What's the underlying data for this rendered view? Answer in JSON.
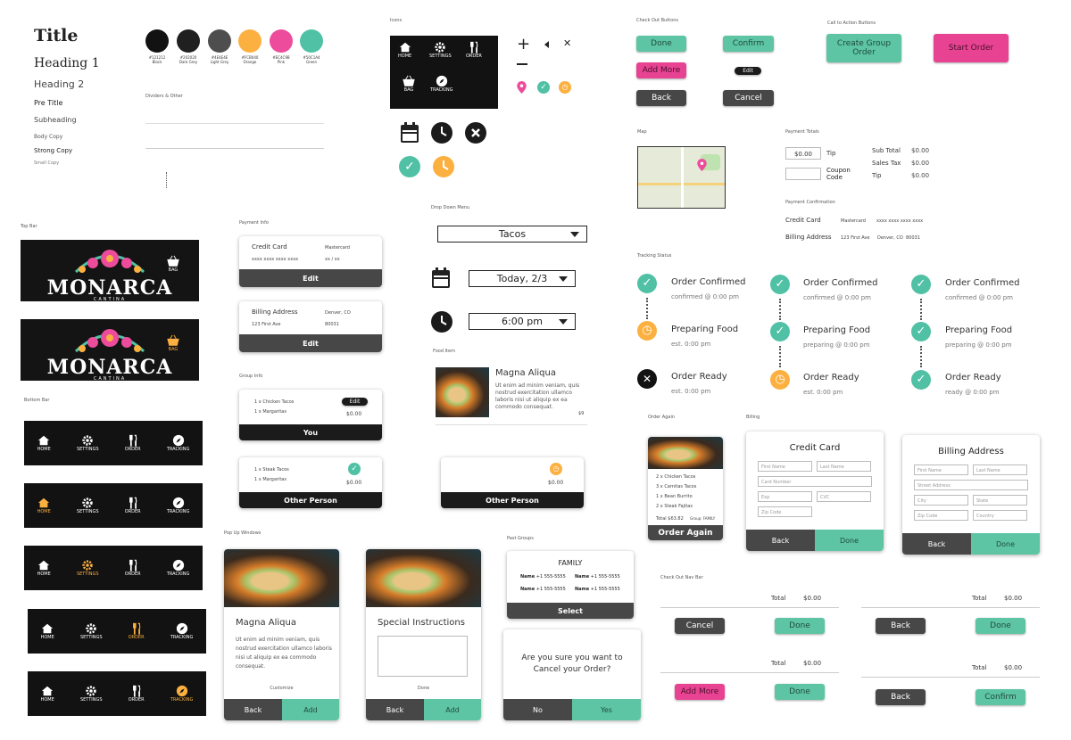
{
  "typography": {
    "title": "Title",
    "h1": "Heading 1",
    "h2": "Heading 2",
    "pre": "Pre Title",
    "sub": "Subheading",
    "body": "Body Copy",
    "strong": "Strong Copy",
    "small": "Small Copy"
  },
  "swatches": [
    {
      "hex": "#121212",
      "name": "Black"
    },
    {
      "hex": "#202020",
      "name": "Dark Grey"
    },
    {
      "hex": "#4E4E4E",
      "name": "Light Grey"
    },
    {
      "hex": "#FCB040",
      "name": "Orange"
    },
    {
      "hex": "#EC4C9B",
      "name": "Pink"
    },
    {
      "hex": "#50C1A4",
      "name": "Green"
    }
  ],
  "colors": {
    "black": "#121212",
    "dark_grey": "#202020",
    "light_grey": "#4E4E4E",
    "orange": "#FCB040",
    "pink": "#EC4C9B",
    "green": "#50C1A4"
  },
  "labels": {
    "dividers": "Dividers & Other",
    "icons": "Icons",
    "checkout_buttons": "Check Out Buttons",
    "cta_buttons": "Call to Action Buttons",
    "top_bar": "Top Bar",
    "bottom_bar": "Bottom Bar",
    "payment_info": "Payment Info",
    "group_info": "Group Info",
    "dropdown": "Drop Down Menu",
    "food_item": "Food Item",
    "map": "Map",
    "payment_totals": "Payment Totals",
    "payment_confirmation": "Payment Confirmation",
    "tracking_status": "Tracking Status",
    "order_again": "Order Again",
    "billing": "Billing",
    "popups": "Pop Up Windows",
    "past_groups": "Past Groups",
    "checkout_nav": "Check Out Nav Bar"
  },
  "nav": {
    "home": "HOME",
    "settings": "SETTINGS",
    "order": "ORDER",
    "bag": "BAG",
    "tracking": "TRACKING"
  },
  "brand": {
    "name": "MONARCA",
    "sub": "CANTINA",
    "bag": "BAG"
  },
  "checkout": {
    "done": "Done",
    "confirm": "Confirm",
    "add_more": "Add More",
    "edit": "Edit",
    "back": "Back",
    "cancel": "Cancel"
  },
  "cta": {
    "create_group": "Create Group Order",
    "start_order": "Start Order"
  },
  "payment_card": {
    "title": "Credit Card",
    "type": "Mastercard",
    "number": "xxxx xxxx xxxx xxxx",
    "exp": "xx / xx",
    "edit": "Edit"
  },
  "billing_card": {
    "title": "Billing Address",
    "city": "Denver, CO",
    "street": "123 First Ave",
    "zip": "80031",
    "edit": "Edit"
  },
  "group_you": {
    "items": [
      "1 x Chicken Tacos",
      "1 x Margaritas"
    ],
    "edit": "Edit",
    "price": "$0.00",
    "name": "You"
  },
  "group_other": {
    "items": [
      "1 x Steak Tacos",
      "1 x Margaritas"
    ],
    "price": "$0.00",
    "name": "Other Person"
  },
  "group_other2": {
    "price": "$0.00",
    "name": "Other Person"
  },
  "dropdowns": {
    "menu": "Tacos",
    "date": "Today, 2/3",
    "time": "6:00 pm"
  },
  "food": {
    "name": "Magna Aliqua",
    "desc": "Ut enim ad minim veniam, quis nostrud exercitation ullamco laboris nisi ut aliquip ex ea commodo consequat.",
    "price": "$9"
  },
  "totals": {
    "tip_value": "$0.00",
    "tip": "Tip",
    "coupon": "Coupon Code",
    "subtotal": "Sub Total",
    "sales_tax": "Sales Tax",
    "tip2": "Tip",
    "v1": "$0.00",
    "v2": "$0.00",
    "v3": "$0.00"
  },
  "confirmation": {
    "card": "Credit Card",
    "card_type": "Mastercard",
    "card_num": "xxxx xxxx xxxx xxxx",
    "billing": "Billing Address",
    "street": "123 First Ave",
    "city": "Denver, CO",
    "zip": "80031"
  },
  "tracking": {
    "confirmed": "Order Confirmed",
    "confirmed_at": "confirmed @ 0:00 pm",
    "preparing": "Preparing Food",
    "est": "est. 0:00 pm",
    "preparing_at": "preparing @ 0:00 pm",
    "ready": "Order Ready",
    "ready_at": "ready @ 0:00 pm"
  },
  "order_again": {
    "items": [
      "2 x Chicken Tacos",
      "3 x Carnitas Tacos",
      "1 x Bean Burrito",
      "2 x Steak Fajitas"
    ],
    "total": "Total $63.82",
    "group": "Group: FAMILY",
    "button": "Order Again"
  },
  "credit_form": {
    "title": "Credit Card",
    "first": "First Name",
    "last": "Last Name",
    "card": "Card Number",
    "exp": "Exp",
    "cvc": "CVC",
    "zip": "Zip Code",
    "back": "Back",
    "done": "Done"
  },
  "billing_form": {
    "title": "Billing Address",
    "first": "First Name",
    "last": "Last Name",
    "street": "Street Address",
    "city": "City",
    "state": "State",
    "zip": "Zip Code",
    "country": "Country",
    "back": "Back",
    "done": "Done"
  },
  "popup1": {
    "title": "Magna Aliqua",
    "desc": "Ut enim ad minim veniam, quis nostrud exercitation ullamco laboris nisi ut aliquip ex ea commodo consequat.",
    "customize": "Customize",
    "back": "Back",
    "add": "Add"
  },
  "popup2": {
    "title": "Special Instructions",
    "done": "Done",
    "back": "Back",
    "add": "Add"
  },
  "past_group": {
    "title": "FAMILY",
    "name": "Name",
    "phone": "+1 555-5555",
    "select": "Select"
  },
  "cancel_popup": {
    "text": "Are you sure you want to Cancel your Order?",
    "no": "No",
    "yes": "Yes"
  },
  "navbar": {
    "total": "Total",
    "amount": "$0.00",
    "cancel": "Cancel",
    "done": "Done",
    "back": "Back",
    "add_more": "Add More",
    "confirm": "Confirm"
  }
}
